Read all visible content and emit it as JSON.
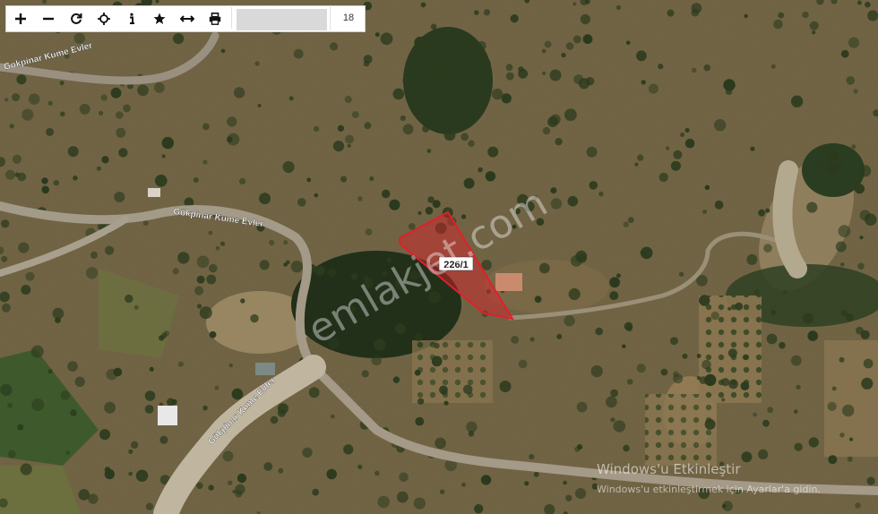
{
  "toolbar": {
    "tools": [
      {
        "name": "zoom-in",
        "glyph": "+"
      },
      {
        "name": "zoom-out",
        "glyph": "−"
      },
      {
        "name": "refresh",
        "glyph": "⟳"
      },
      {
        "name": "locate",
        "glyph": "⊕"
      },
      {
        "name": "info",
        "glyph": "i"
      },
      {
        "name": "favorite",
        "glyph": "★"
      },
      {
        "name": "measure",
        "glyph": "↔"
      },
      {
        "name": "print",
        "glyph": "⎙"
      }
    ],
    "zoom_level": "18"
  },
  "map": {
    "road_labels": [
      "Gokpinar Kume Evler",
      "Gökpinar Kume Evler",
      "Gökpinar Kume Evler"
    ],
    "parcel_label": "226/1",
    "parcel_color": "#e0202a",
    "watermark": "emlakjet.com"
  },
  "windows_notice": {
    "title": "Windows'u Etkinleştir",
    "subtitle": "Windows'u etkinleştirmek için Ayarlar'a gidin."
  }
}
